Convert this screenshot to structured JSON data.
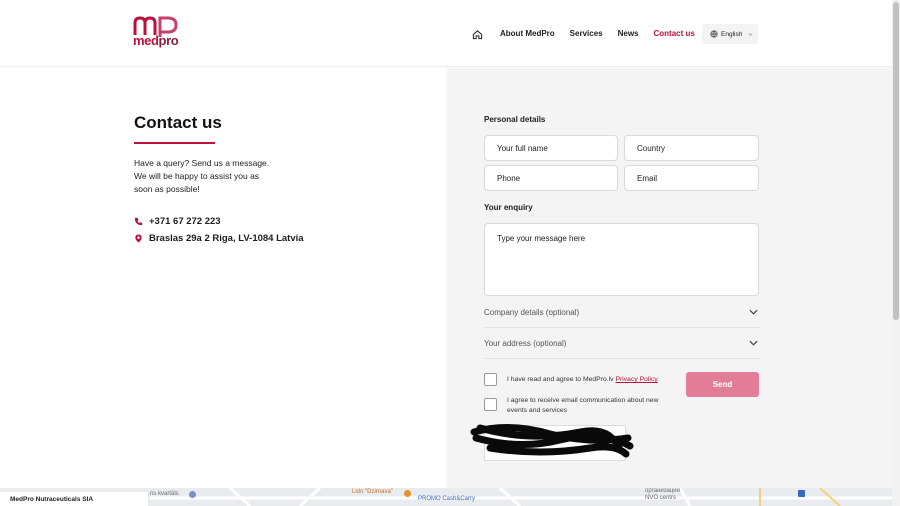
{
  "header": {
    "logo_monogram": "mp",
    "logo_word_a": "med",
    "logo_word_b": "pro",
    "nav": {
      "home_icon": "home-icon",
      "items": [
        "About MedPro",
        "Services",
        "News",
        "Contact us"
      ],
      "active": "Contact us"
    },
    "language": {
      "icon": "globe-icon",
      "label": "English"
    }
  },
  "contact": {
    "title": "Contact us",
    "intro_lines": [
      "Have a query? Send us a message.",
      "We will be happy to assist you as",
      "soon as possible!"
    ],
    "phone": "+371 67 272 223",
    "address": "Braslas 29a 2 Riga, LV-1084 Latvia"
  },
  "form": {
    "personal_details_label": "Personal details",
    "fields": {
      "full_name": {
        "placeholder": "Your full name",
        "value": ""
      },
      "country": {
        "placeholder": "Country",
        "value": ""
      },
      "phone": {
        "placeholder": "Phone",
        "value": ""
      },
      "email": {
        "placeholder": "Email",
        "value": ""
      }
    },
    "enquiry_label": "Your enquiry",
    "message_placeholder": "Type your message here",
    "company_details_label": "Company details (optional)",
    "address_label": "Your address (optional)",
    "consent_prefix": "I have read and agree to MedPro.lv",
    "privacy_link": "Privacy Policy",
    "newsletter_line1": "I agree to receive email communication about new",
    "newsletter_line2": "events and services",
    "send_label": "Send"
  },
  "map": {
    "card_title": "MedPro Nutraceuticals SIA",
    "labels": [
      "ns kvartāls",
      "Lido \"Dzirnava\"",
      "PROMO Cash&Carry",
      "организации",
      "NVO centrs"
    ]
  },
  "colors": {
    "brand": "#b8123d",
    "send_button": "#e27d98",
    "panel": "#f4f4f4"
  }
}
